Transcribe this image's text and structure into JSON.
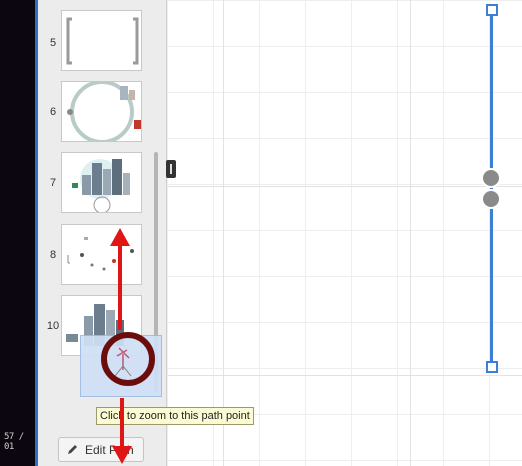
{
  "left_strip": {
    "timecode": "57 / 01"
  },
  "slides": [
    {
      "number": "5"
    },
    {
      "number": "6"
    },
    {
      "number": "7"
    },
    {
      "number": "8"
    },
    {
      "number": "10"
    }
  ],
  "tooltip": "Click to zoom to this path point",
  "edit_path_button": {
    "label": "Edit Path",
    "icon": "pencil-icon"
  },
  "colors": {
    "selection": "#3b7fd6",
    "annotation_arrow": "#e01515",
    "drag_ring": "#6b0d0d"
  }
}
